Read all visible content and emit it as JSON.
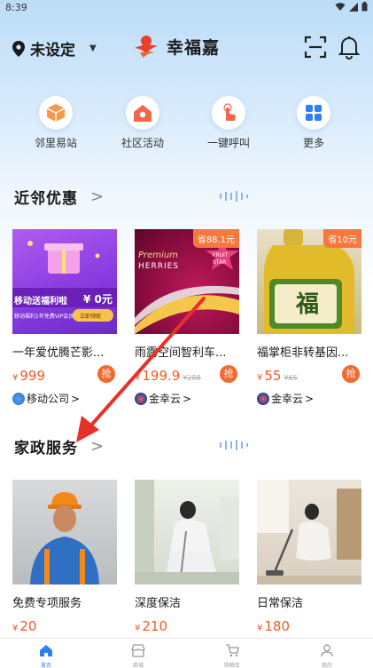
{
  "status_bar": {
    "time": "8:39"
  },
  "header": {
    "location_label": "未设定",
    "brand_name": "幸福嘉"
  },
  "quick_links": [
    {
      "label": "邻里易站",
      "icon": "box-icon"
    },
    {
      "label": "社区活动",
      "icon": "home-icon"
    },
    {
      "label": "一键呼叫",
      "icon": "tap-icon"
    },
    {
      "label": "更多",
      "icon": "grid-icon"
    }
  ],
  "nearby_deals": {
    "title": "近邻优惠",
    "more": ">",
    "items": [
      {
        "title": "一年爱优腾芒影...",
        "price_symbol": "¥",
        "price": "999",
        "old_price": "",
        "save_tag": "",
        "shop": "移动公司",
        "shop_arrow": ">",
        "grab": "抢",
        "image_text": {
          "main": "移动送福利啦",
          "price_text": "¥ 0元",
          "sub": "移动福利1年免费VIP会员",
          "btn": "立即领取"
        }
      },
      {
        "title": "雨露空间智利车...",
        "price_symbol": "¥",
        "price": "199.9",
        "old_price": "¥288",
        "save_tag": "省88.1元",
        "shop": "金幸云",
        "shop_arrow": ">",
        "grab": "抢",
        "image_text": {
          "line1": "Premium",
          "line2": "HERRIES",
          "star1": "FRUIT",
          "star2": "STAR"
        }
      },
      {
        "title": "福掌柜非转基因...",
        "price_symbol": "¥",
        "price": "55",
        "old_price": "¥65",
        "save_tag": "省10元",
        "shop": "金幸云",
        "shop_arrow": ">",
        "grab": "抢",
        "image_text": {
          "label": "福"
        }
      }
    ]
  },
  "housekeeping": {
    "title": "家政服务",
    "more": ">",
    "items": [
      {
        "title": "免费专项服务",
        "price_symbol": "¥",
        "price": "20"
      },
      {
        "title": "深度保洁",
        "price_symbol": "¥",
        "price": "210"
      },
      {
        "title": "日常保洁",
        "price_symbol": "¥",
        "price": "180"
      }
    ]
  },
  "tabbar": [
    {
      "label": "首页",
      "icon": "home-tab-icon",
      "active": true
    },
    {
      "label": "商城",
      "icon": "shop-tab-icon",
      "active": false
    },
    {
      "label": "购物车",
      "icon": "cart-tab-icon",
      "active": false
    },
    {
      "label": "我的",
      "icon": "user-tab-icon",
      "active": false
    }
  ],
  "colors": {
    "accent_blue": "#2e7ff2",
    "price_orange": "#f25a25",
    "tag_orange": "#f7773c",
    "annotation_red": "#e8302a"
  }
}
